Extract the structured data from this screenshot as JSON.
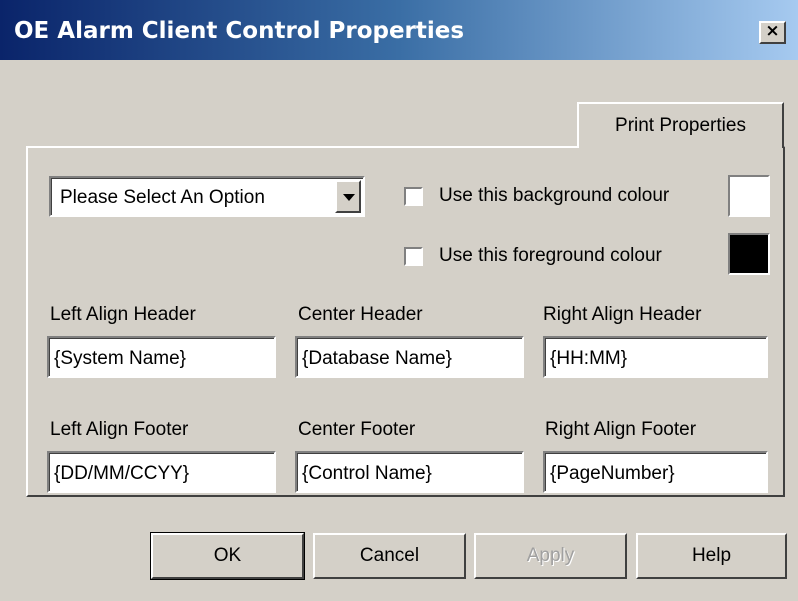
{
  "window": {
    "title": "OE Alarm Client Control Properties",
    "close_label": "×"
  },
  "tab": {
    "label": "Print Properties"
  },
  "dropdown": {
    "selected": "Please Select An Option"
  },
  "background_colour": {
    "label": "Use this background colour",
    "color": "#ffffff"
  },
  "foreground_colour": {
    "label": "Use this foreground colour",
    "color": "#000000"
  },
  "headers": {
    "left": {
      "label": "Left Align Header",
      "value": "{System Name}"
    },
    "center": {
      "label": "Center Header",
      "value": "{Database Name}"
    },
    "right": {
      "label": "Right Align Header",
      "value": "{HH:MM}"
    }
  },
  "footers": {
    "left": {
      "label": "Left Align Footer",
      "value": "{DD/MM/CCYY}"
    },
    "center": {
      "label": "Center Footer",
      "value": "{Control Name}"
    },
    "right": {
      "label": "Right Align Footer",
      "value": "{PageNumber}"
    }
  },
  "buttons": {
    "ok": "OK",
    "cancel": "Cancel",
    "apply": "Apply",
    "help": "Help"
  }
}
